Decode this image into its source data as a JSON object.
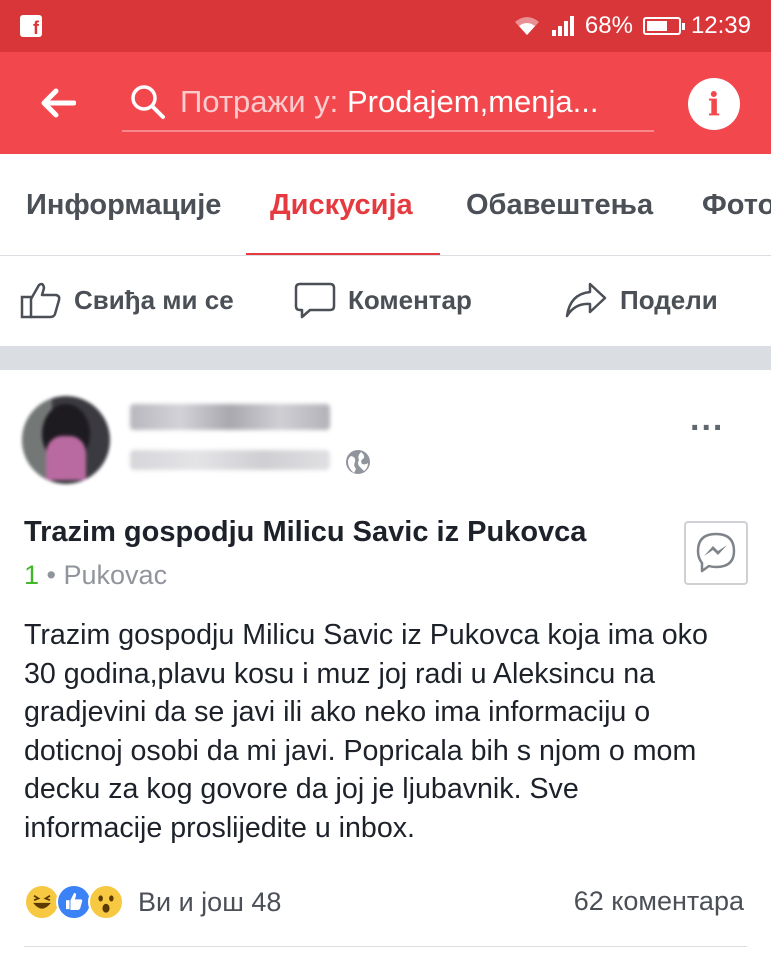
{
  "status_bar": {
    "app_badge": "f",
    "battery": "68%",
    "battery_level": 0.68,
    "time": "12:39"
  },
  "app_bar": {
    "search_prefix": "Потражи у:",
    "search_group": "Prodajem,menja...",
    "info_label": "i"
  },
  "tabs": [
    {
      "label": "Информације",
      "active": false
    },
    {
      "label": "Дискусија",
      "active": true
    },
    {
      "label": "Обавештења",
      "active": false
    },
    {
      "label": "Фото",
      "active": false
    }
  ],
  "actions": {
    "like": "Свиђа ми се",
    "comment": "Коментар",
    "share": "Подели"
  },
  "post": {
    "more": "...",
    "title": "Trazim gospodju Milicu Savic iz Pukovca",
    "count": "1",
    "separator": "•",
    "location": "Pukovac",
    "body_lines": [
      "Trazim gospodju Milicu Savic iz Pukovca koja ima oko",
      "30 godina,plavu kosu i muz joj radi u Aleksincu na",
      "gradjevini da se javi ili ako neko ima informaciju o",
      "doticnoj osobi da mi javi. Popricala bih s njom o mom",
      "decku za kog govore da joj je ljubavnik. Sve",
      "informacije proslijedite u inbox."
    ],
    "reactions_text": "Ви и још 48",
    "comments_count": "62 коментара"
  },
  "colors": {
    "status_bar": "#d9363a",
    "app_bar": "#f2474c",
    "accent": "#e53a3f",
    "text": "#1d2129",
    "muted": "#90949c",
    "green": "#42b72a"
  }
}
